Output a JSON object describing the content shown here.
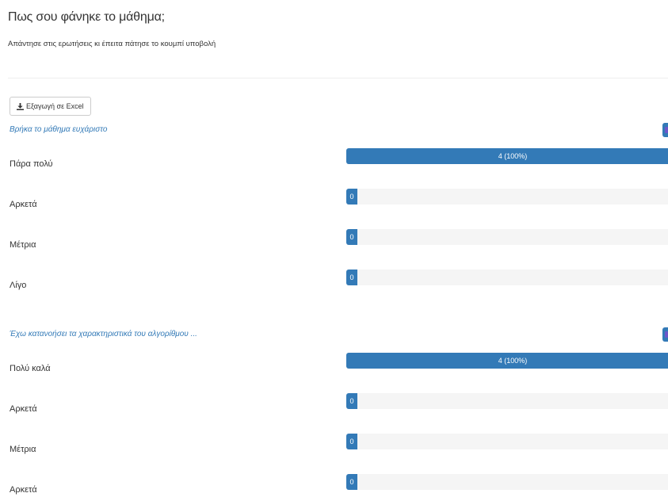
{
  "header": {
    "title": "Πως σου φάνηκε το μάθημα;",
    "subtitle": "Απάντησε στις ερωτήσεις κι έπειτα πάτησε το κουμπί υποβολή"
  },
  "toolbar": {
    "export_label": "Εξαγωγή σε Excel",
    "export_icon": "download-icon"
  },
  "colors": {
    "accent": "#337ab7",
    "track": "#f5f5f5",
    "marker_inner": "#6b57c9"
  },
  "questions": [
    {
      "text": "Βρήκα το μάθημα ευχάριστο",
      "options": [
        {
          "label": "Πάρα πολύ",
          "count": 4,
          "percent": 100,
          "bar_text": "4 (100%)"
        },
        {
          "label": "Αρκετά",
          "count": 0,
          "percent": 0,
          "bar_text": "0"
        },
        {
          "label": "Μέτρια",
          "count": 0,
          "percent": 0,
          "bar_text": "0"
        },
        {
          "label": "Λίγο",
          "count": 0,
          "percent": 0,
          "bar_text": "0"
        }
      ]
    },
    {
      "text": "Έχω κατανοήσει τα χαρακτηριστικά του αλγορίθμου ...",
      "options": [
        {
          "label": "Πολύ καλά",
          "count": 4,
          "percent": 100,
          "bar_text": "4 (100%)"
        },
        {
          "label": "Αρκετά",
          "count": 0,
          "percent": 0,
          "bar_text": "0"
        },
        {
          "label": "Μέτρια",
          "count": 0,
          "percent": 0,
          "bar_text": "0"
        },
        {
          "label": "Αρκετά",
          "count": 0,
          "percent": 0,
          "bar_text": "0"
        }
      ]
    }
  ]
}
